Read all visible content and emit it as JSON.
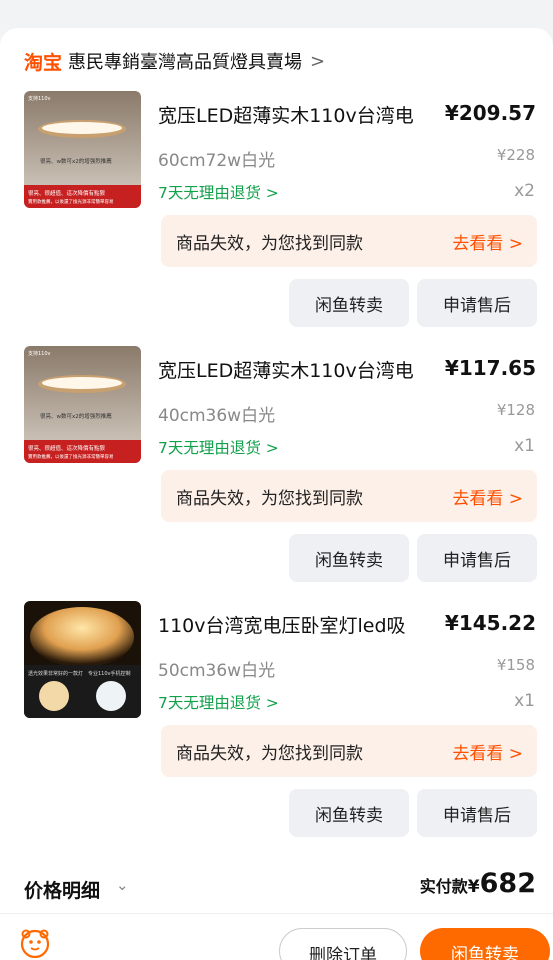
{
  "shop": {
    "logo": "淘宝",
    "name": "惠民專銷臺灣高品質燈具賣場",
    "arrow": ">"
  },
  "items": [
    {
      "title": "宽压LED超薄实木110v台湾电",
      "price": "¥209.57",
      "spec": "60cm72w白光",
      "original_price": "¥228",
      "refund": "7天无理由退货 >",
      "qty": "x2",
      "invalid_msg": "商品失效，为您找到同款",
      "invalid_action": "去看看 >",
      "btn_resell": "闲鱼转卖",
      "btn_aftersale": "申请售后",
      "thumb_text": {
        "corner": "支持110v",
        "mid": "很亮、w数可x2的增强烈推薦",
        "red1": "很亮、很超值、這次降價有點狠",
        "red2": "實用款推薦，以後還了換光源非常簡單容易"
      }
    },
    {
      "title": "宽压LED超薄实木110v台湾电",
      "price": "¥117.65",
      "spec": "40cm36w白光",
      "original_price": "¥128",
      "refund": "7天无理由退货 >",
      "qty": "x1",
      "invalid_msg": "商品失效，为您找到同款",
      "invalid_action": "去看看 >",
      "btn_resell": "闲鱼转卖",
      "btn_aftersale": "申请售后",
      "thumb_text": {
        "corner": "支持110v",
        "mid": "很亮、w数可x2的增强烈推薦",
        "red1": "很亮、很超值、這次降價有點狠",
        "red2": "實用款推薦，以後還了換光源非常簡單容易"
      }
    },
    {
      "title": "110v台湾宽电压卧室灯led吸",
      "price": "¥145.22",
      "spec": "50cm36w白光",
      "original_price": "¥158",
      "refund": "7天无理由退货 >",
      "qty": "x1",
      "invalid_msg": "商品失效，为您找到同款",
      "invalid_action": "去看看 >",
      "btn_resell": "闲鱼转卖",
      "btn_aftersale": "申请售后",
      "thumb_text": {
        "corner": "",
        "mid": "",
        "red1": "透光效果非常好的一款灯",
        "red2": "专业110v手机控制"
      }
    }
  ],
  "detail": {
    "label": "价格明细",
    "chevron": "⌄",
    "paid_label": "实付款",
    "currency": "¥",
    "amount": "682"
  },
  "bottom": {
    "delete_label": "删除订单",
    "resell_label": "闲鱼转卖"
  },
  "colors": {
    "accent": "#ff5000",
    "refund_green": "#12a14b",
    "invalid_bg": "#fdf0e8"
  }
}
